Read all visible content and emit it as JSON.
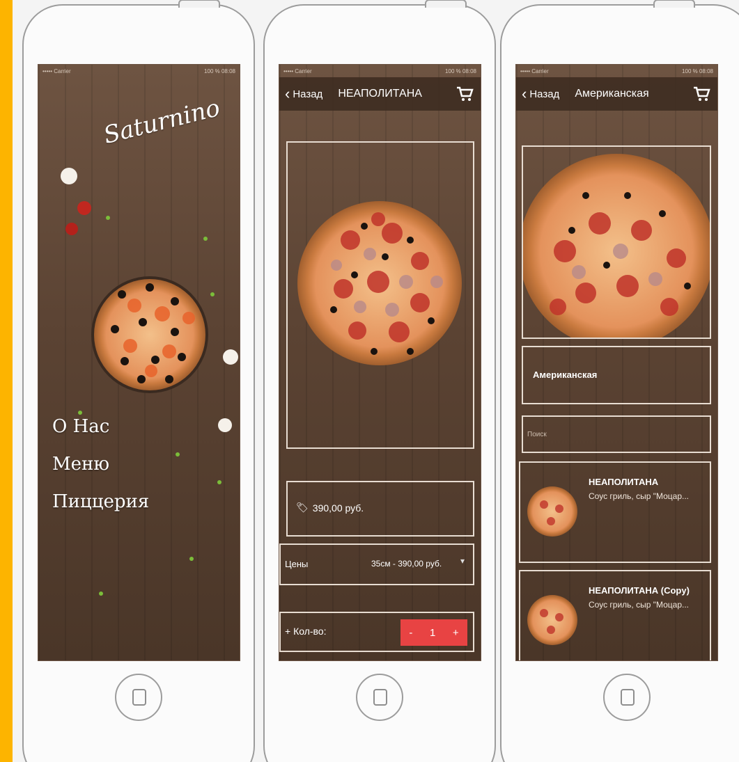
{
  "status": {
    "carrier": "••••• Carrier",
    "battery": "100 %",
    "time": "08:08"
  },
  "home": {
    "logo": "Saturnino",
    "menu": [
      "О Нас",
      "Меню",
      "Пиццерия"
    ]
  },
  "detail": {
    "back_label": "Назад",
    "title": "НЕАПОЛИТАНА",
    "price": "390,00 руб.",
    "prices_label": "Цены",
    "prices_value": "35см - 390,00 руб.",
    "qty_label": "+ Кол-во:",
    "qty_minus": "-",
    "qty_value": "1",
    "qty_plus": "+"
  },
  "list": {
    "back_label": "Назад",
    "title": "Американская",
    "category": "Американская",
    "search_placeholder": "Поиск",
    "items": [
      {
        "title": "НЕАПОЛИТАНА",
        "desc": "Соус гриль, сыр \"Моцар..."
      },
      {
        "title": "НЕАПОЛИТАНА (Copy)",
        "desc": "Соус гриль, сыр \"Моцар..."
      }
    ]
  },
  "colors": {
    "background": "#fdb400",
    "accent": "#e84343",
    "wood": "#5b4333"
  }
}
